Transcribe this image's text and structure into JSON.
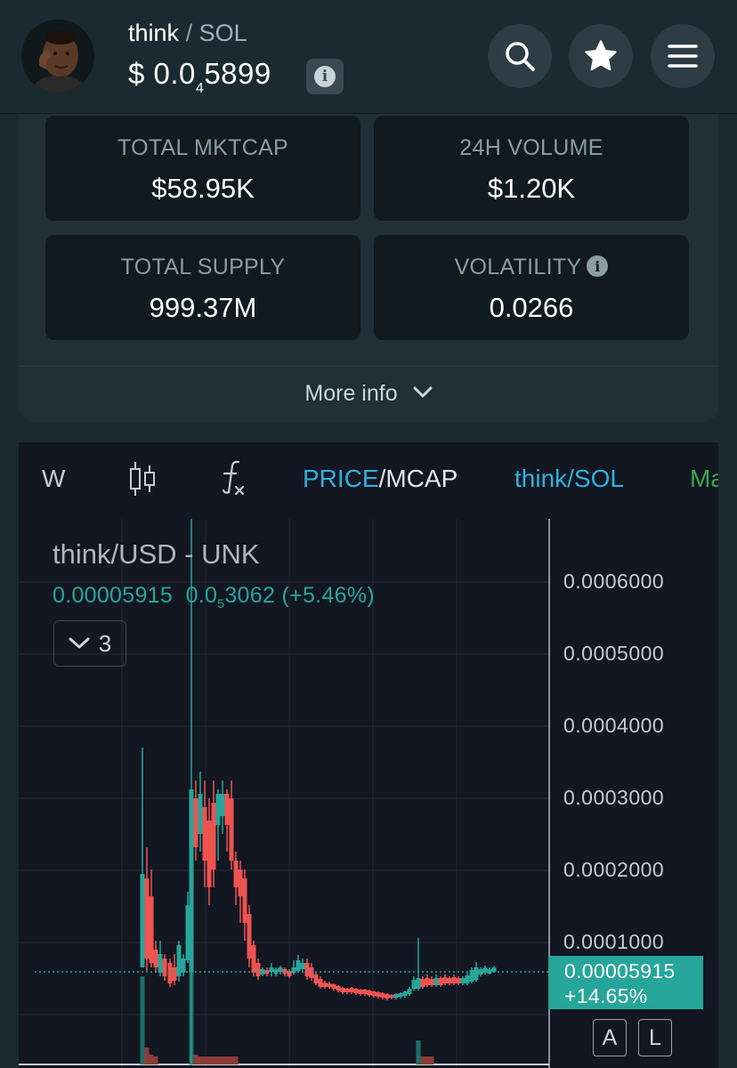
{
  "header": {
    "token_symbol": "think",
    "separator": "/",
    "quote_symbol": "SOL",
    "price_prefix": "$ 0.0",
    "price_zero_count": "4",
    "price_digits": "5899"
  },
  "stats": {
    "market_cap": {
      "label": "TOTAL MKTCAP",
      "value": "$58.95K"
    },
    "volume_24h": {
      "label": "24H VOLUME",
      "value": "$1.20K"
    },
    "total_supply": {
      "label": "TOTAL SUPPLY",
      "value": "999.37M"
    },
    "volatility": {
      "label": "VOLATILITY",
      "value": "0.0266"
    },
    "more_info_label": "More info"
  },
  "chart_toolbar": {
    "interval": "W",
    "price_label": "PRICE",
    "slash": "/",
    "mcap_label": "MCAP",
    "pair_label": "think/SOL",
    "more_label": "Ma"
  },
  "chart_legend": {
    "title": "think/USD - UNK",
    "last_value": "0.00005915",
    "change_prefix": "0.0",
    "change_zero_count": "5",
    "change_digits": "3062",
    "change_pct": "(+5.46%)",
    "indicators_count": "3"
  },
  "y_axis": {
    "labels": [
      "0.0006000",
      "0.0005000",
      "0.0004000",
      "0.0003000",
      "0.0002000",
      "0.0001000"
    ]
  },
  "price_tag": {
    "price": "0.00005915",
    "change": "+14.65%"
  },
  "scale_buttons": {
    "auto": "A",
    "log": "L"
  },
  "colors": {
    "up": "#26a69a",
    "down": "#ef5350",
    "accent_blue": "#2fb1dd",
    "accent_green": "#38a84f"
  },
  "icons": [
    "search-icon",
    "star-icon",
    "menu-icon",
    "info-icon",
    "chevron-down-icon",
    "candles-icon",
    "indicators-icon"
  ]
}
